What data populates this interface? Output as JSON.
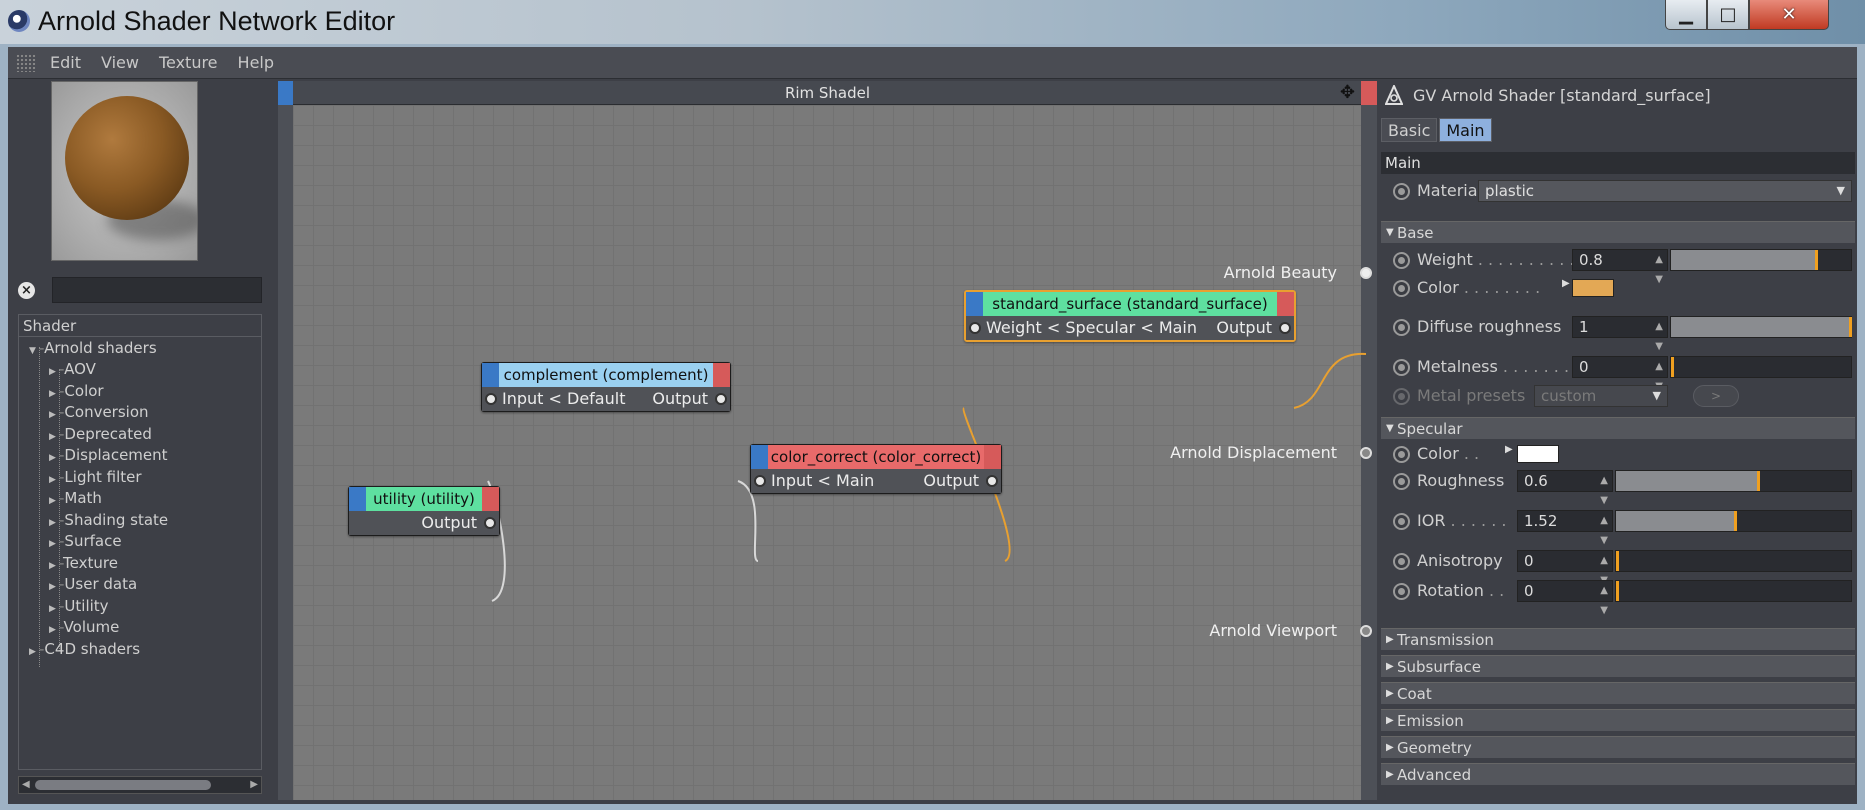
{
  "window": {
    "title": "Arnold Shader Network Editor",
    "min_glyph": "▁",
    "max_glyph": "□",
    "close_glyph": "✕"
  },
  "menu": [
    "Edit",
    "View",
    "Texture",
    "Help"
  ],
  "left_panel": {
    "search_value": "",
    "tree_header": "Shader",
    "tree": {
      "root": "Arnold shaders",
      "children": [
        "AOV",
        "Color",
        "Conversion",
        "Deprecated",
        "Displacement",
        "Light filter",
        "Math",
        "Shading state",
        "Surface",
        "Texture",
        "User data",
        "Utility",
        "Volume"
      ],
      "other_root": "C4D shaders"
    }
  },
  "editor": {
    "title": "Rim Shadel",
    "move_glyph": "✥",
    "nodes": {
      "utility": {
        "title": "utility (utility)",
        "output": "Output"
      },
      "complement": {
        "title": "complement (complement)",
        "input": "Input < Default",
        "output": "Output"
      },
      "color_correct": {
        "title": "color_correct (color_correct)",
        "input": "Input < Main",
        "output": "Output"
      },
      "standard_surface": {
        "title": "standard_surface (standard_surface)",
        "input": "Weight < Specular < Main",
        "output": "Output"
      }
    },
    "outputs": {
      "beauty": "Arnold Beauty",
      "displacement": "Arnold Displacement",
      "viewport": "Arnold Viewport"
    }
  },
  "attributes": {
    "title": "GV Arnold Shader [standard_surface]",
    "tabs": [
      "Basic",
      "Main"
    ],
    "section": "Main",
    "material_label": "Material",
    "material_value": "plastic",
    "base": {
      "label": "Base",
      "weight_label": "Weight",
      "weight_dots": " . . . . . . . . . .",
      "weight": "0.8",
      "color_label": "Color",
      "color_dots": " . . . . . . . .",
      "color_hex": "#e3a855",
      "diffuse_label": "Diffuse roughness",
      "diffuse": "1",
      "metalness_label": "Metalness",
      "metalness_dots": " . . . . . . .",
      "metalness": "0",
      "presets_label": "Metal presets",
      "presets_value": "custom",
      "presets_btn": ">"
    },
    "specular": {
      "label": "Specular",
      "color_label": "Color",
      "color_dots": " . .",
      "color_hex": "#ffffff",
      "roughness_label": "Roughness",
      "roughness": "0.6",
      "ior_label": "IOR",
      "ior_dots": " . . . . . .",
      "ior": "1.52",
      "anisotropy_label": "Anisotropy",
      "anisotropy": "0",
      "rotation_label": "Rotation",
      "rotation_dots": " . .",
      "rotation": "0"
    },
    "collapsed_groups": [
      "Transmission",
      "Subsurface",
      "Coat",
      "Emission",
      "Geometry",
      "Advanced"
    ]
  },
  "colors": {
    "accent_orange": "#e8a030",
    "port_blue": "#3a79c6",
    "port_red": "#d65a5a",
    "node_utility": "#5ee0a0",
    "node_complement": "#9ad0f0",
    "node_color_correct": "#e86a6a",
    "node_standard_surface": "#5ee0a0",
    "tab_active": "#8eb0de"
  }
}
